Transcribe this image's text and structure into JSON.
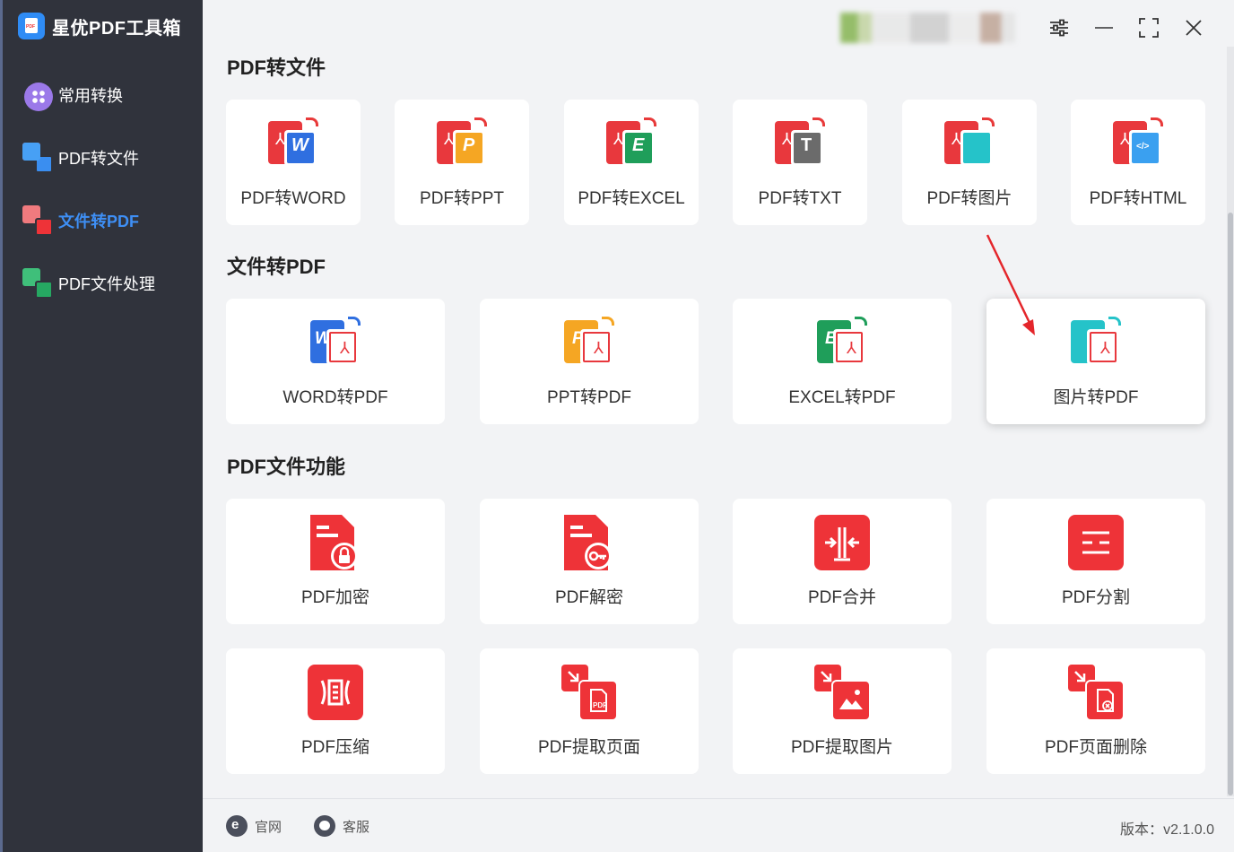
{
  "app": {
    "name": "星优PDF工具箱",
    "version_label": "版本：",
    "version": "v2.1.0.0"
  },
  "sidebar": {
    "items": [
      {
        "label": "常用转换",
        "icon": "apps-icon",
        "active": false
      },
      {
        "label": "PDF转文件",
        "icon": "pdf-to-file-icon",
        "active": false
      },
      {
        "label": "文件转PDF",
        "icon": "file-to-pdf-icon",
        "active": true
      },
      {
        "label": "PDF文件处理",
        "icon": "pdf-process-icon",
        "active": false
      }
    ]
  },
  "sections": {
    "pdf_to_file": {
      "title": "PDF转文件",
      "items": [
        "PDF转WORD",
        "PDF转PPT",
        "PDF转EXCEL",
        "PDF转TXT",
        "PDF转图片",
        "PDF转HTML"
      ]
    },
    "file_to_pdf": {
      "title": "文件转PDF",
      "items": [
        "WORD转PDF",
        "PPT转PDF",
        "EXCEL转PDF",
        "图片转PDF"
      ]
    },
    "pdf_functions": {
      "title": "PDF文件功能",
      "row1": [
        "PDF加密",
        "PDF解密",
        "PDF合并",
        "PDF分割"
      ],
      "row2": [
        "PDF压缩",
        "PDF提取页面",
        "PDF提取图片",
        "PDF页面删除"
      ]
    }
  },
  "bottom": {
    "website": "官网",
    "support": "客服"
  },
  "colors": {
    "sidebar_bg": "#30333c",
    "accent": "#3e8ff5",
    "pdf_red": "#ee3338",
    "word_blue": "#2f6fe0",
    "ppt_orange": "#f5a623",
    "excel_green": "#1f9e5a",
    "txt_gray": "#6b6b6b",
    "image_teal": "#25c3c9",
    "html_blue": "#3aa0f0"
  }
}
